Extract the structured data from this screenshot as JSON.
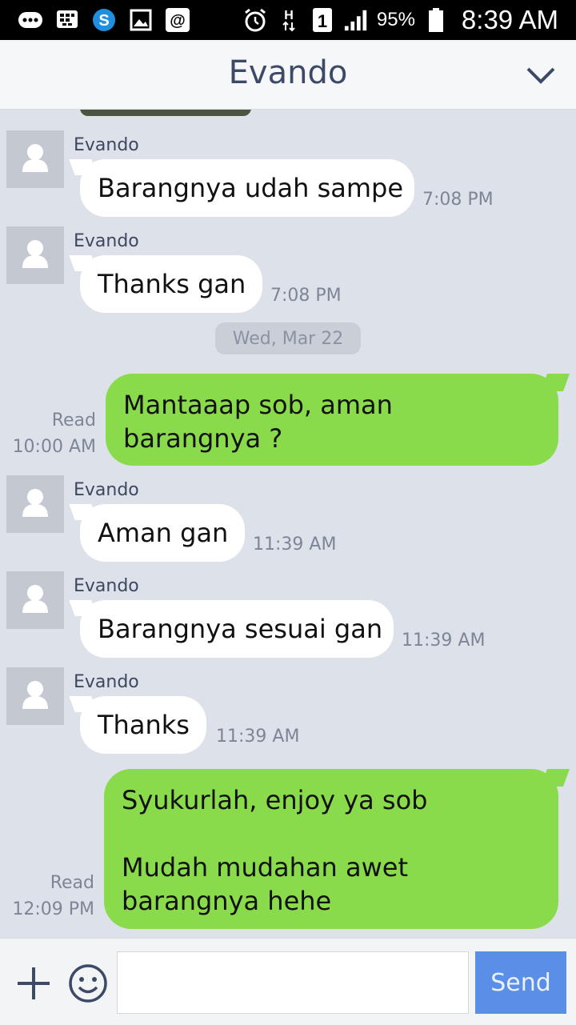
{
  "status_bar": {
    "battery_percent": "95%",
    "time": "8:39 AM",
    "icons": [
      "chat-bubbles-icon",
      "blackberry-icon",
      "skype-icon",
      "image-icon",
      "at-sign-icon",
      "alarm-icon",
      "hspa-icon",
      "sim1-icon",
      "signal-icon",
      "battery-icon"
    ]
  },
  "header": {
    "title": "Evando"
  },
  "chat": {
    "messages": [
      {
        "sender": "Evando",
        "text": "Barangnya udah sampe",
        "time": "7:08 PM"
      },
      {
        "sender": "Evando",
        "text": "Thanks gan",
        "time": "7:08 PM"
      },
      {
        "date_label": "Wed, Mar 22"
      },
      {
        "outgoing": true,
        "lines": [
          "Mantaaap sob, aman",
          "barangnya ?"
        ],
        "read": "Read",
        "time": "10:00 AM"
      },
      {
        "sender": "Evando",
        "text": "Aman gan",
        "time": "11:39 AM"
      },
      {
        "sender": "Evando",
        "text": "Barangnya sesuai gan",
        "time": "11:39 AM"
      },
      {
        "sender": "Evando",
        "text": "Thanks",
        "time": "11:39 AM"
      },
      {
        "outgoing": true,
        "lines": [
          "Syukurlah, enjoy ya sob",
          "",
          "Mudah mudahan awet",
          "barangnya hehe"
        ],
        "read": "Read",
        "time": "12:09 PM"
      }
    ]
  },
  "footer": {
    "input_value": "",
    "send_label": "Send"
  },
  "colors": {
    "outgoing_bubble": "#8adb4c",
    "send_button": "#5b8ee6",
    "background": "#dde2ea",
    "title": "#3d4a67"
  }
}
